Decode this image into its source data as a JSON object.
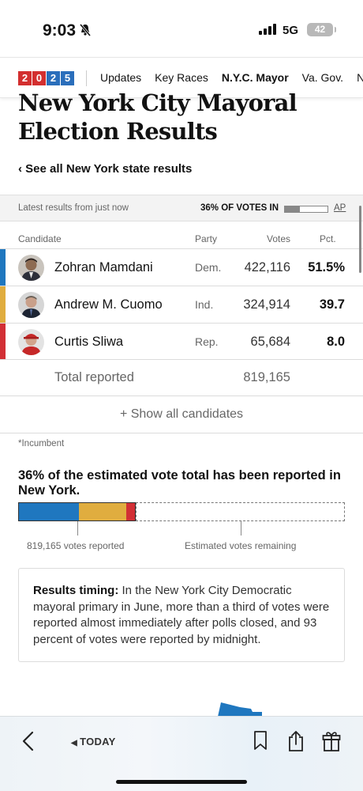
{
  "status_bar": {
    "time": "9:03",
    "network": "5G",
    "battery": "42"
  },
  "nav": {
    "logo_digits": [
      "2",
      "0",
      "2",
      "5"
    ],
    "items": [
      "Updates",
      "Key Races",
      "N.Y.C. Mayor",
      "Va. Gov.",
      "N"
    ],
    "active": "N.Y.C. Mayor"
  },
  "page": {
    "title_line1": "New York City Mayoral",
    "title_line2": "Election Results",
    "see_all": "‹ See all New York state results"
  },
  "results_strip": {
    "latest": "Latest results from just now",
    "votes_in": "36% OF VOTES IN",
    "votes_in_fraction": 0.36,
    "source": "AP"
  },
  "table": {
    "headers": {
      "candidate": "Candidate",
      "party": "Party",
      "votes": "Votes",
      "pct": "Pct."
    },
    "rows": [
      {
        "name": "Zohran Mamdani",
        "party": "Dem.",
        "votes": "422,116",
        "pct": "51.5%",
        "color": "#1f77bf"
      },
      {
        "name": "Andrew M. Cuomo",
        "party": "Ind.",
        "votes": "324,914",
        "pct": "39.7",
        "color": "#e0ad3f"
      },
      {
        "name": "Curtis Sliwa",
        "party": "Rep.",
        "votes": "65,684",
        "pct": "8.0",
        "color": "#d22f35"
      }
    ],
    "total_label": "Total reported",
    "total_votes": "819,165",
    "show_all": "+ Show all candidates"
  },
  "incumbent_note": "*Incumbent",
  "estimate": {
    "heading": "36% of the estimated vote total has been reported in New York.",
    "reported_fraction": 0.36,
    "reported_label": "819,165 votes reported",
    "remaining_label": "Estimated votes remaining"
  },
  "timing": {
    "label": "Results timing:",
    "text": " In the New York City Democratic mayoral primary in June, more than a third of votes were reported almost immediately after polls closed, and 93 percent of votes were reported by midnight."
  },
  "toolbar": {
    "today": "TODAY"
  },
  "colors": {
    "dem": "#1f77bf",
    "ind": "#e0ad3f",
    "rep": "#d22f35",
    "logo_red": "#d32f2f",
    "logo_blue": "#2a6ebb"
  }
}
